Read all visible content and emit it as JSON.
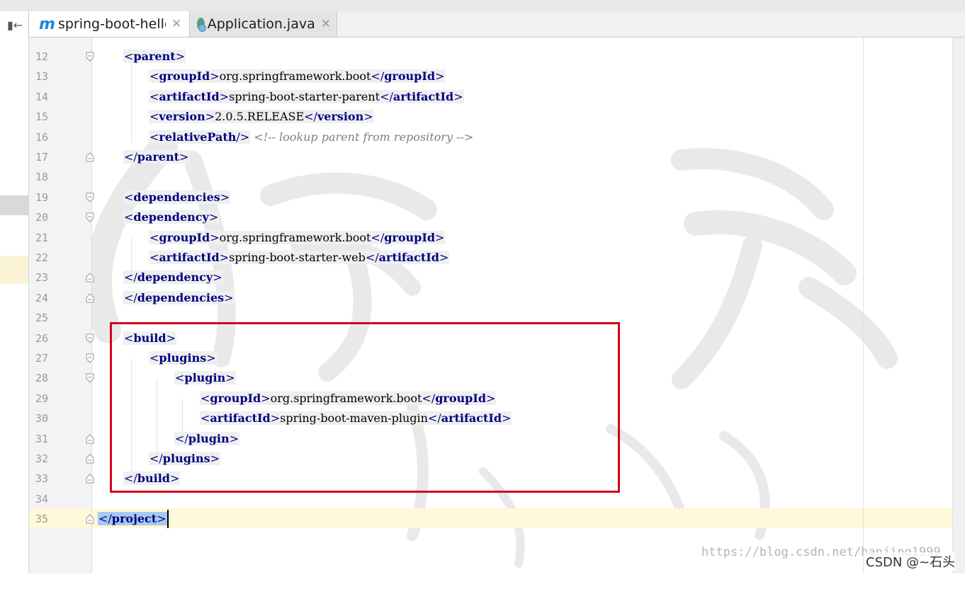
{
  "tabs": [
    {
      "label": "spring-boot-hello",
      "icon": "maven-m-icon",
      "active": true
    },
    {
      "label": "Application.java",
      "icon": "java-class-icon",
      "active": false
    }
  ],
  "editor": {
    "lines": [
      {
        "num": "12",
        "indent": 1,
        "parts": [
          [
            "bk",
            "<"
          ],
          [
            "nm",
            "parent"
          ],
          [
            "bk",
            ">"
          ]
        ],
        "fold": "open"
      },
      {
        "num": "13",
        "indent": 2,
        "parts": [
          [
            "bk",
            "<"
          ],
          [
            "nm",
            "groupId"
          ],
          [
            "bk",
            ">"
          ],
          [
            "tx",
            "org.springframework.boot"
          ],
          [
            "bk",
            "</"
          ],
          [
            "nm",
            "groupId"
          ],
          [
            "bk",
            ">"
          ]
        ]
      },
      {
        "num": "14",
        "indent": 2,
        "parts": [
          [
            "bk",
            "<"
          ],
          [
            "nm",
            "artifactId"
          ],
          [
            "bk",
            ">"
          ],
          [
            "tx",
            "spring-boot-starter-parent"
          ],
          [
            "bk",
            "</"
          ],
          [
            "nm",
            "artifactId"
          ],
          [
            "bk",
            ">"
          ]
        ]
      },
      {
        "num": "15",
        "indent": 2,
        "parts": [
          [
            "bk",
            "<"
          ],
          [
            "nm",
            "version"
          ],
          [
            "bk",
            ">"
          ],
          [
            "tx",
            "2.0.5.RELEASE"
          ],
          [
            "bk",
            "</"
          ],
          [
            "nm",
            "version"
          ],
          [
            "bk",
            ">"
          ]
        ]
      },
      {
        "num": "16",
        "indent": 2,
        "parts": [
          [
            "bk",
            "<"
          ],
          [
            "nm",
            "relativePath"
          ],
          [
            "bk",
            "/>"
          ]
        ],
        "comment": "<!-- lookup parent from repository -->"
      },
      {
        "num": "17",
        "indent": 1,
        "parts": [
          [
            "bk",
            "</"
          ],
          [
            "nm",
            "parent"
          ],
          [
            "bk",
            ">"
          ]
        ],
        "fold": "close"
      },
      {
        "num": "18",
        "indent": 0,
        "parts": []
      },
      {
        "num": "19",
        "indent": 1,
        "parts": [
          [
            "bk",
            "<"
          ],
          [
            "nm",
            "dependencies"
          ],
          [
            "bk",
            ">"
          ]
        ],
        "fold": "open"
      },
      {
        "num": "20",
        "indent": 1,
        "parts": [
          [
            "bk",
            "<"
          ],
          [
            "nm",
            "dependency"
          ],
          [
            "bk",
            ">"
          ]
        ],
        "fold": "open"
      },
      {
        "num": "21",
        "indent": 2,
        "parts": [
          [
            "bk",
            "<"
          ],
          [
            "nm",
            "groupId"
          ],
          [
            "bk",
            ">"
          ],
          [
            "tx",
            "org.springframework.boot"
          ],
          [
            "bk",
            "</"
          ],
          [
            "nm",
            "groupId"
          ],
          [
            "bk",
            ">"
          ]
        ]
      },
      {
        "num": "22",
        "indent": 2,
        "parts": [
          [
            "bk",
            "<"
          ],
          [
            "nm",
            "artifactId"
          ],
          [
            "bk",
            ">"
          ],
          [
            "tx",
            "spring-boot-starter-web"
          ],
          [
            "bk",
            "</"
          ],
          [
            "nm",
            "artifactId"
          ],
          [
            "bk",
            ">"
          ]
        ]
      },
      {
        "num": "23",
        "indent": 1,
        "parts": [
          [
            "bk",
            "</"
          ],
          [
            "nm",
            "dependency"
          ],
          [
            "bk",
            ">"
          ]
        ],
        "fold": "close"
      },
      {
        "num": "24",
        "indent": 1,
        "parts": [
          [
            "bk",
            "</"
          ],
          [
            "nm",
            "dependencies"
          ],
          [
            "bk",
            ">"
          ]
        ],
        "fold": "close"
      },
      {
        "num": "25",
        "indent": 0,
        "parts": []
      },
      {
        "num": "26",
        "indent": 1,
        "parts": [
          [
            "bk",
            "<"
          ],
          [
            "nm",
            "build"
          ],
          [
            "bk",
            ">"
          ]
        ],
        "fold": "open"
      },
      {
        "num": "27",
        "indent": 2,
        "parts": [
          [
            "bk",
            "<"
          ],
          [
            "nm",
            "plugins"
          ],
          [
            "bk",
            ">"
          ]
        ],
        "fold": "open"
      },
      {
        "num": "28",
        "indent": 3,
        "parts": [
          [
            "bk",
            "<"
          ],
          [
            "nm",
            "plugin"
          ],
          [
            "bk",
            ">"
          ]
        ],
        "fold": "open"
      },
      {
        "num": "29",
        "indent": 4,
        "parts": [
          [
            "bk",
            "<"
          ],
          [
            "nm",
            "groupId"
          ],
          [
            "bk",
            ">"
          ],
          [
            "tx",
            "org.springframework.boot"
          ],
          [
            "bk",
            "</"
          ],
          [
            "nm",
            "groupId"
          ],
          [
            "bk",
            ">"
          ]
        ]
      },
      {
        "num": "30",
        "indent": 4,
        "parts": [
          [
            "bk",
            "<"
          ],
          [
            "nm",
            "artifactId"
          ],
          [
            "bk",
            ">"
          ],
          [
            "tx",
            "spring-boot-maven-plugin"
          ],
          [
            "bk",
            "</"
          ],
          [
            "nm",
            "artifactId"
          ],
          [
            "bk",
            ">"
          ]
        ]
      },
      {
        "num": "31",
        "indent": 3,
        "parts": [
          [
            "bk",
            "</"
          ],
          [
            "nm",
            "plugin"
          ],
          [
            "bk",
            ">"
          ]
        ],
        "fold": "close"
      },
      {
        "num": "32",
        "indent": 2,
        "parts": [
          [
            "bk",
            "</"
          ],
          [
            "nm",
            "plugins"
          ],
          [
            "bk",
            ">"
          ]
        ],
        "fold": "close"
      },
      {
        "num": "33",
        "indent": 1,
        "parts": [
          [
            "bk",
            "</"
          ],
          [
            "nm",
            "build"
          ],
          [
            "bk",
            ">"
          ]
        ],
        "fold": "close"
      },
      {
        "num": "34",
        "indent": 0,
        "parts": []
      },
      {
        "num": "35",
        "indent": 0,
        "parts": [
          [
            "bk",
            "</"
          ],
          [
            "nm",
            "project"
          ],
          [
            "bk",
            ">"
          ]
        ],
        "fold": "close",
        "selected": true,
        "current": true
      }
    ]
  },
  "watermark_url": "https://blog.csdn.net/hanjing1999",
  "watermark_brand": "CSDN @~石头",
  "colors": {
    "tag_bracket": "#000080",
    "tag_name": "#000080",
    "comment": "#808080",
    "highlight_box": "#d0021b",
    "selection": "#a6caf0",
    "current_line": "#fff8d9"
  }
}
